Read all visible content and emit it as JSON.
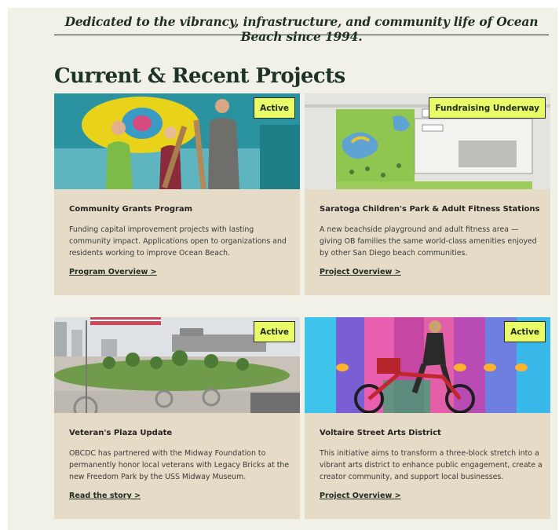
{
  "tagline": "Dedicated to the vibrancy, infrastructure, and community life of Ocean Beach since 1994.",
  "section_title": "Current & Recent Projects",
  "colors": {
    "badge_bg": "#e9fb66",
    "card_bg": "#e5dbc7",
    "page_bg": "#f1f1e7",
    "heading": "#1d3327"
  },
  "projects": [
    {
      "status": "Active",
      "title": "Community Grants Program",
      "description": "Funding capital improvement projects with lasting community impact. Applications open to organizations and residents working to improve Ocean Beach.",
      "link_label": "Program Overview >"
    },
    {
      "status": "Fundraising Underway",
      "title": "Saratoga Children's Park & Adult Fitness Stations",
      "description": "A new beachside playground and adult fitness area — giving OB families the same world-class amenities enjoyed by other San Diego beach communities.",
      "link_label": "Project Overview >"
    },
    {
      "status": "Active",
      "title": "Veteran's Plaza Update",
      "description": "OBCDC has partnered with the Midway Foundation to permanently honor local veterans with Legacy Bricks at the new Freedom Park by the USS Midway Museum.",
      "link_label": "Read the story >"
    },
    {
      "status": "Active",
      "title": "Voltaire Street Arts District",
      "description": "This initiative aims to transform a three-block stretch into a vibrant arts district to enhance public engagement, create a creator community, and support local businesses.",
      "link_label": "Project Overview >"
    }
  ]
}
